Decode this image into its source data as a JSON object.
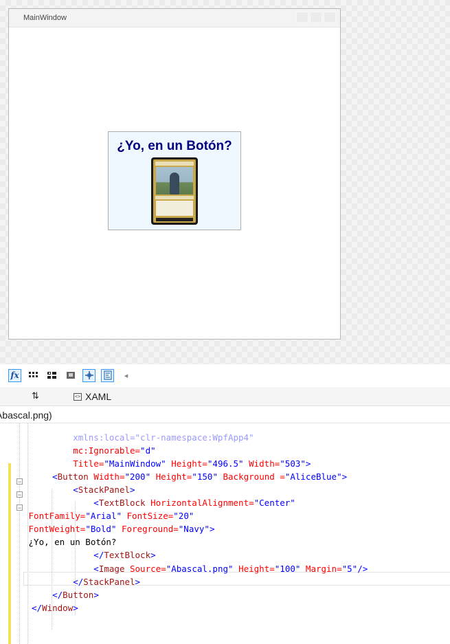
{
  "designer": {
    "window_title": "MainWindow",
    "button_text": "¿Yo, en un Botón?",
    "colors": {
      "button_background": "#F0F8FF",
      "button_foreground": "#000080"
    },
    "image_icon": "card-image"
  },
  "toolbar": {
    "icons": [
      "fx-icon",
      "grid-icon",
      "snap-grid-icon",
      "artboard-icon",
      "snap-lines-icon",
      "code-view-icon",
      "arrow-left-icon"
    ],
    "fx_label": "fx",
    "arrow_glyph": "◂"
  },
  "tabs": {
    "swap_label": "⇅",
    "xaml_label": "XAML"
  },
  "breadcrumb": {
    "text": "Abascal.png)"
  },
  "code": {
    "lines": [
      {
        "segments": [
          {
            "t": "        xmlns:local=",
            "c": "c-ns"
          },
          {
            "t": "\"clr-namespace:WpfApp4\"",
            "c": "c-ns"
          }
        ]
      },
      {
        "segments": [
          {
            "t": "        mc:Ignorable=",
            "c": "c-attr"
          },
          {
            "t": "\"d\"",
            "c": "c-val"
          }
        ]
      },
      {
        "segments": [
          {
            "t": "        Title=",
            "c": "c-attr"
          },
          {
            "t": "\"MainWindow\"",
            "c": "c-val"
          },
          {
            "t": " Height=",
            "c": "c-attr"
          },
          {
            "t": "\"496.5\"",
            "c": "c-val"
          },
          {
            "t": " Width=",
            "c": "c-attr"
          },
          {
            "t": "\"503\"",
            "c": "c-val"
          },
          {
            "t": ">",
            "c": "c-punct"
          }
        ]
      },
      {
        "segments": [
          {
            "t": "    <",
            "c": "c-punct"
          },
          {
            "t": "Button",
            "c": "c-tag"
          },
          {
            "t": " Width=",
            "c": "c-attr"
          },
          {
            "t": "\"200\"",
            "c": "c-val"
          },
          {
            "t": " Height=",
            "c": "c-attr"
          },
          {
            "t": "\"150\"",
            "c": "c-val"
          },
          {
            "t": " Background =",
            "c": "c-attr"
          },
          {
            "t": "\"AliceBlue\"",
            "c": "c-val"
          },
          {
            "t": ">",
            "c": "c-punct"
          }
        ]
      },
      {
        "segments": [
          {
            "t": "        <",
            "c": "c-punct"
          },
          {
            "t": "StackPanel",
            "c": "c-tag"
          },
          {
            "t": ">",
            "c": "c-punct"
          }
        ]
      },
      {
        "segments": [
          {
            "t": "            <",
            "c": "c-punct"
          },
          {
            "t": "TextBlock",
            "c": "c-tag"
          },
          {
            "t": " HorizontalAlignment=",
            "c": "c-attr"
          },
          {
            "t": "\"Center\"",
            "c": "c-val"
          }
        ]
      },
      {
        "segments": [
          {
            "t": " FontFamily=",
            "c": "c-attr"
          },
          {
            "t": "\"Arial\"",
            "c": "c-val"
          },
          {
            "t": " FontSize=",
            "c": "c-attr"
          },
          {
            "t": "\"20\"",
            "c": "c-val"
          }
        ]
      },
      {
        "segments": [
          {
            "t": " FontWeight=",
            "c": "c-attr"
          },
          {
            "t": "\"Bold\"",
            "c": "c-val"
          },
          {
            "t": " Foreground=",
            "c": "c-attr"
          },
          {
            "t": "\"Navy\"",
            "c": "c-val"
          },
          {
            "t": ">",
            "c": "c-punct"
          }
        ]
      },
      {
        "segments": [
          {
            "t": " ¿Yo, en un Botón?",
            "c": "c-text"
          }
        ]
      },
      {
        "segments": [
          {
            "t": "            </",
            "c": "c-punct"
          },
          {
            "t": "TextBlock",
            "c": "c-tag"
          },
          {
            "t": ">",
            "c": "c-punct"
          }
        ]
      },
      {
        "segments": [
          {
            "t": "            <",
            "c": "c-punct"
          },
          {
            "t": "Image",
            "c": "c-tag"
          },
          {
            "t": " Source=",
            "c": "c-attr"
          },
          {
            "t": "\"Abascal.png\"",
            "c": "c-val"
          },
          {
            "t": " Height=",
            "c": "c-attr"
          },
          {
            "t": "\"100\"",
            "c": "c-val"
          },
          {
            "t": " Margin=",
            "c": "c-attr"
          },
          {
            "t": "\"5\"",
            "c": "c-val"
          },
          {
            "t": "/>",
            "c": "c-punct"
          }
        ]
      },
      {
        "segments": [
          {
            "t": "        </",
            "c": "c-punct"
          },
          {
            "t": "StackPanel",
            "c": "c-tag"
          },
          {
            "t": ">",
            "c": "c-punct"
          }
        ]
      },
      {
        "segments": [
          {
            "t": "    </",
            "c": "c-punct"
          },
          {
            "t": "Button",
            "c": "c-tag"
          },
          {
            "t": ">",
            "c": "c-punct"
          }
        ]
      },
      {
        "segments": [
          {
            "t": "</",
            "c": "c-punct"
          },
          {
            "t": "Window",
            "c": "c-tag"
          },
          {
            "t": ">",
            "c": "c-punct"
          }
        ]
      }
    ]
  }
}
